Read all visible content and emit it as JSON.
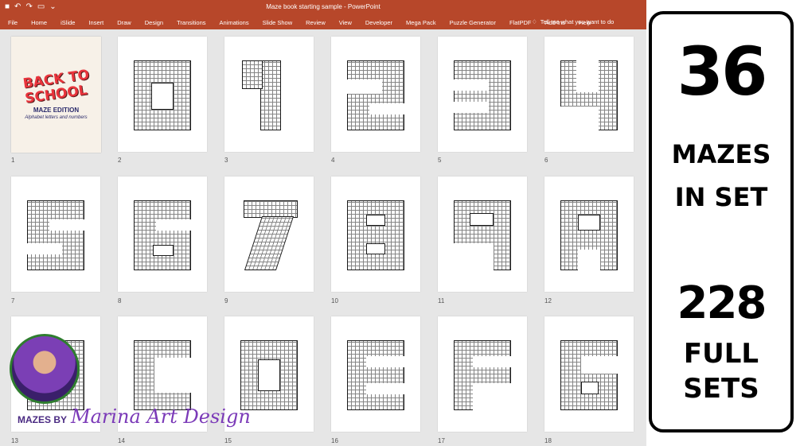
{
  "window": {
    "title": "Maze book starting sample - PowerPoint",
    "qat_icons": [
      "save-icon",
      "undo-icon",
      "redo-icon",
      "present-icon",
      "customize-icon"
    ]
  },
  "ribbon": {
    "tabs": [
      "File",
      "Home",
      "iSlide",
      "Insert",
      "Draw",
      "Design",
      "Transitions",
      "Animations",
      "Slide Show",
      "Review",
      "View",
      "Developer",
      "Mega Pack",
      "Puzzle Generator",
      "FlatPDF",
      "Add-ins",
      "Help"
    ],
    "tell_me": "Tell me what you want to do"
  },
  "cover": {
    "title_line1": "BACK TO",
    "title_line2": "SCHOOL",
    "subtitle": "MAZE EDITION",
    "tagline": "Alphabet letters and numbers"
  },
  "slide_numbers": [
    "1",
    "2",
    "3",
    "4",
    "5",
    "6",
    "7",
    "8",
    "9",
    "10",
    "11",
    "12",
    "13",
    "14",
    "15",
    "16",
    "17",
    "18"
  ],
  "credit": {
    "by": "MAZES BY",
    "name": "Marina Art Design"
  },
  "promo": {
    "count": "36",
    "line1": "MAZES",
    "line2": "IN SET",
    "sets": "228",
    "line3": "FULL",
    "line4": "SETS"
  },
  "colors": {
    "ribbon": "#b7472a",
    "workspace": "#e6e6e6",
    "credit": "#7b3ab8"
  }
}
